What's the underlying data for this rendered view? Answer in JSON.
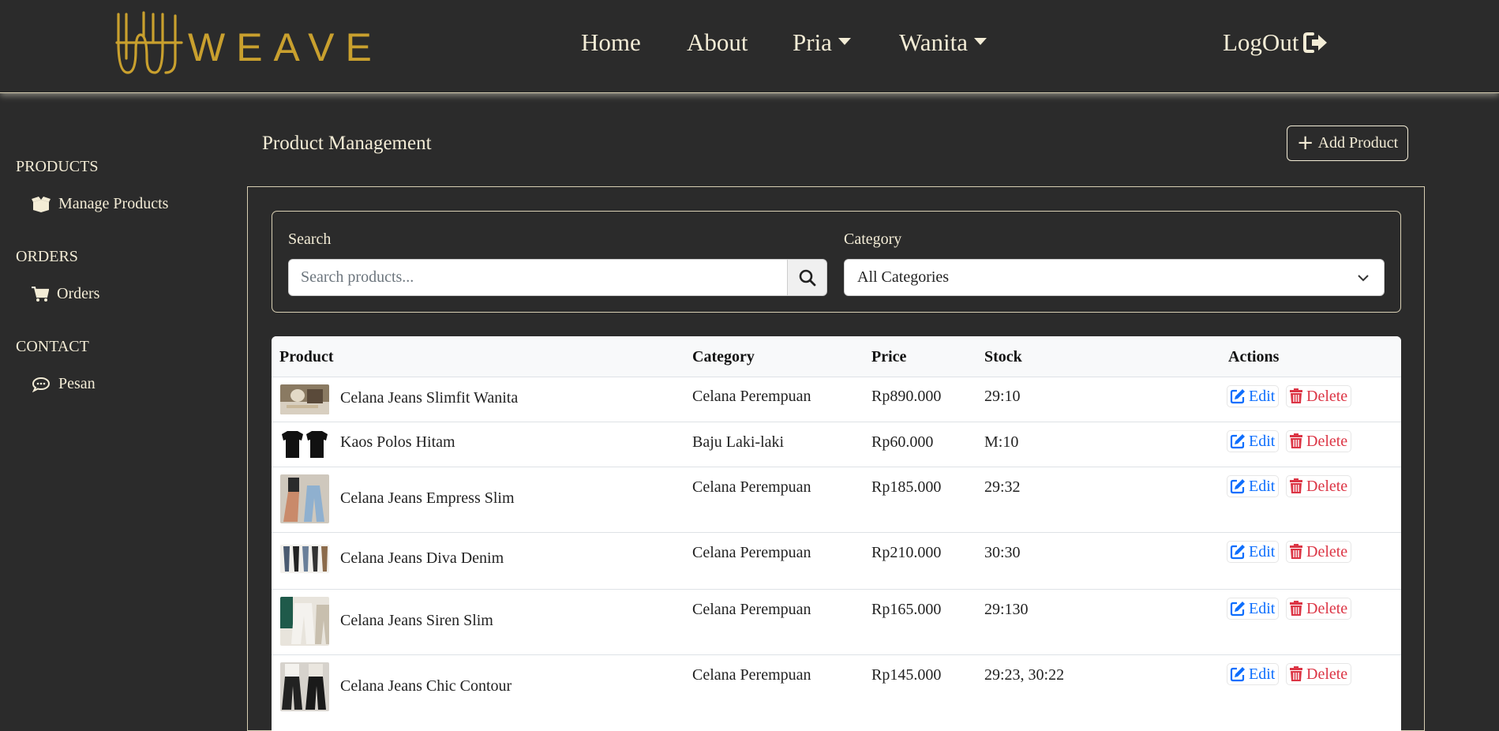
{
  "brand": {
    "name": "WEAVE",
    "color": "#c9a02e"
  },
  "nav": {
    "home": "Home",
    "about": "About",
    "pria": "Pria",
    "wanita": "Wanita",
    "logout": "LogOut"
  },
  "sidebar": {
    "products_heading": "PRODUCTS",
    "manage_products": "Manage Products",
    "orders_heading": "ORDERS",
    "orders": "Orders",
    "contact_heading": "CONTACT",
    "pesan": "Pesan"
  },
  "page": {
    "title": "Product Management",
    "add_button": "Add Product"
  },
  "filters": {
    "search_label": "Search",
    "search_placeholder": "Search products...",
    "category_label": "Category",
    "category_selected": "All Categories"
  },
  "table": {
    "headers": {
      "product": "Product",
      "category": "Category",
      "price": "Price",
      "stock": "Stock",
      "actions": "Actions"
    },
    "edit_label": "Edit",
    "delete_label": "Delete",
    "rows": [
      {
        "name": "Celana Jeans Slimfit Wanita",
        "category": "Celana Perempuan",
        "price": "Rp890.000",
        "stock": "29:10"
      },
      {
        "name": "Kaos Polos Hitam",
        "category": "Baju Laki-laki",
        "price": "Rp60.000",
        "stock": "M:10"
      },
      {
        "name": "Celana Jeans Empress Slim",
        "category": "Celana Perempuan",
        "price": "Rp185.000",
        "stock": "29:32"
      },
      {
        "name": "Celana Jeans Diva Denim",
        "category": "Celana Perempuan",
        "price": "Rp210.000",
        "stock": "30:30"
      },
      {
        "name": "Celana Jeans Siren Slim",
        "category": "Celana Perempuan",
        "price": "Rp165.000",
        "stock": "29:130"
      },
      {
        "name": "Celana Jeans Chic Contour",
        "category": "Celana Perempuan",
        "price": "Rp145.000",
        "stock": "29:23, 30:22"
      }
    ]
  }
}
